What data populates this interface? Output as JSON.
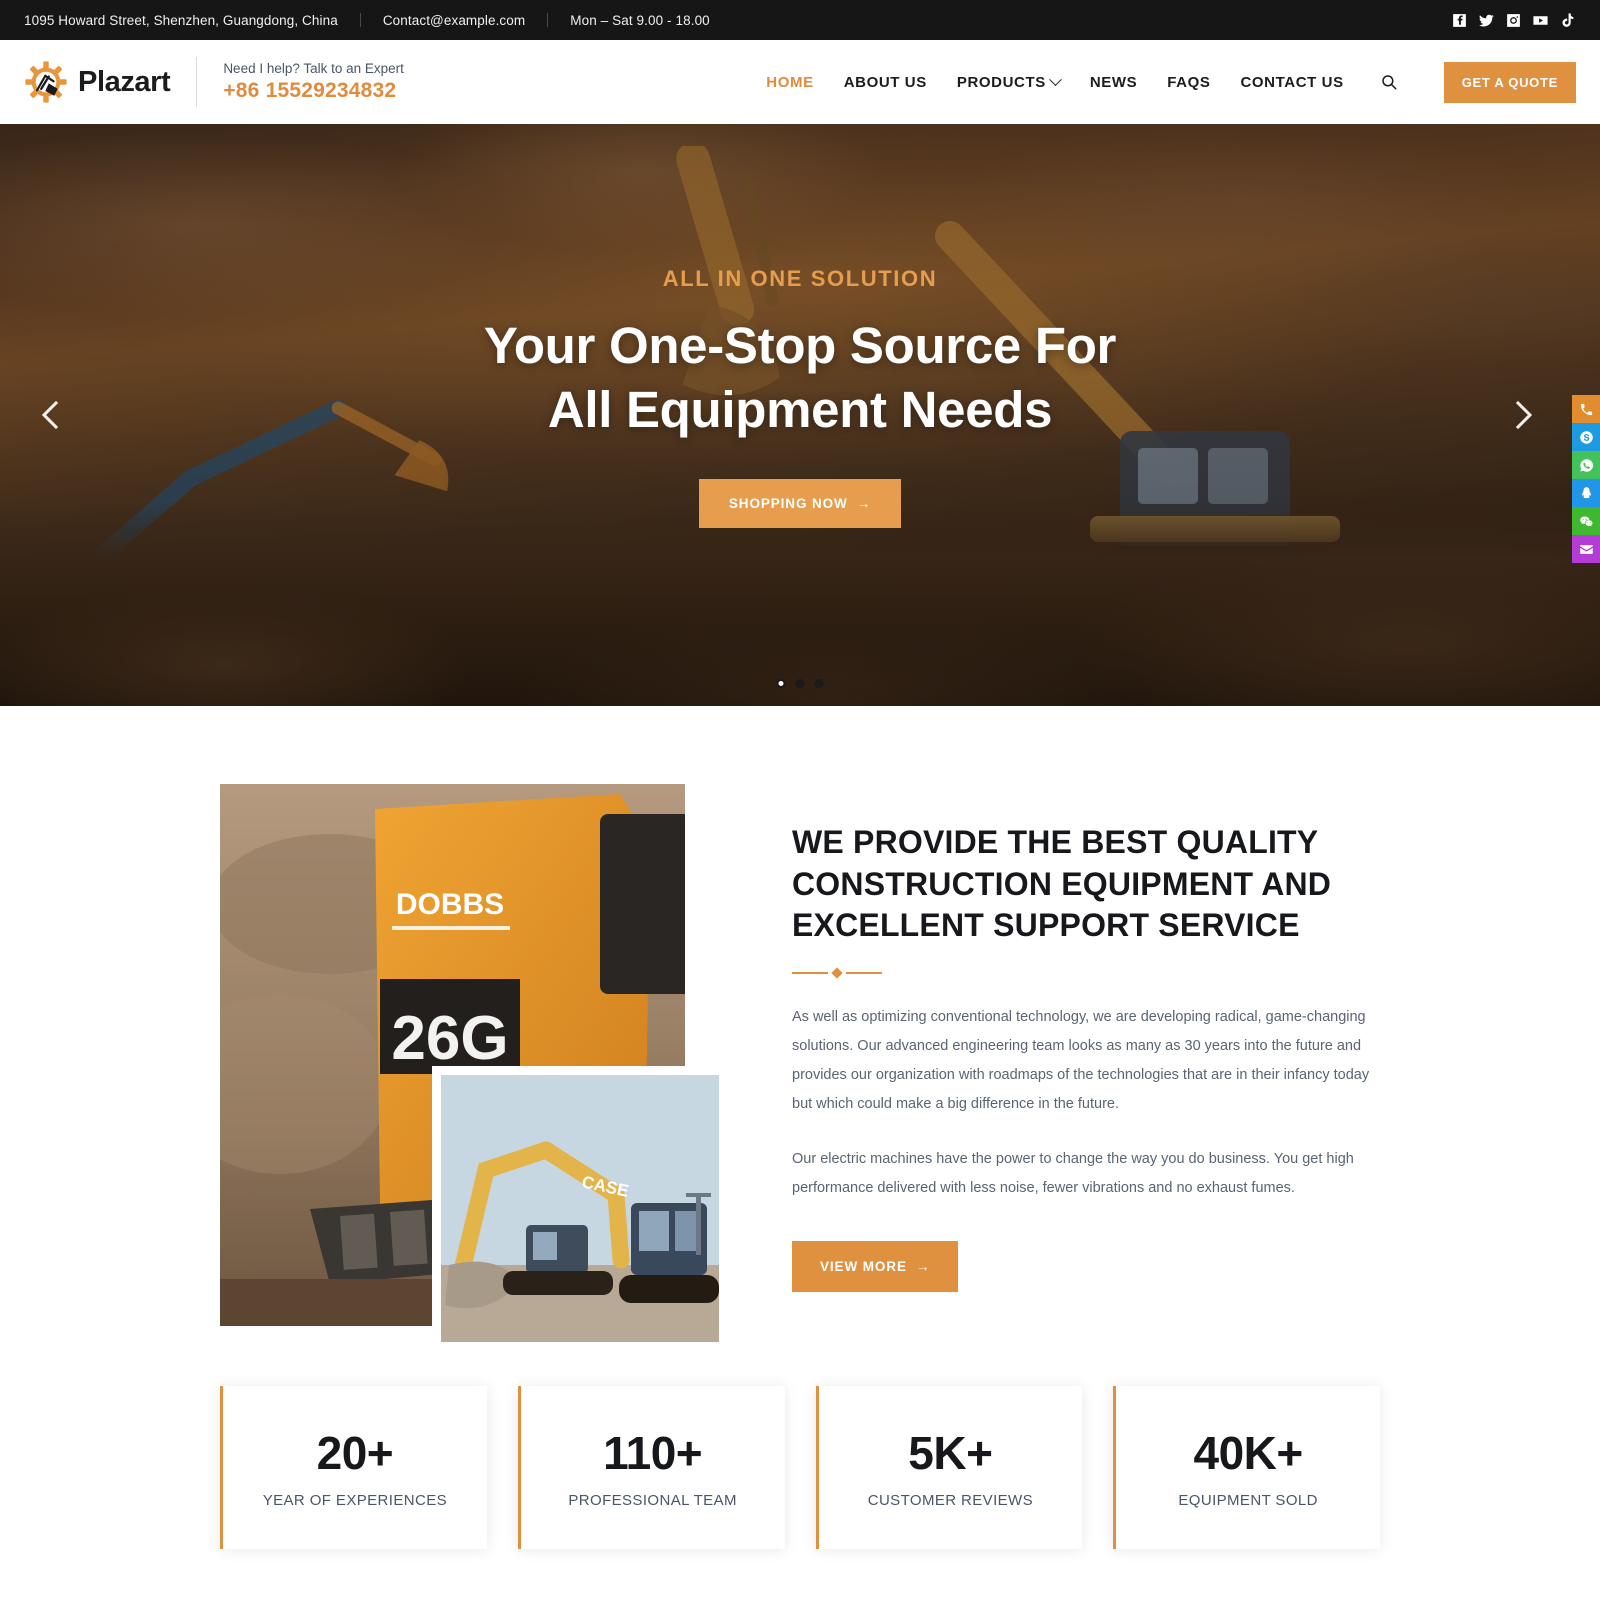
{
  "topbar": {
    "address": "1095 Howard Street, Shenzhen, Guangdong, China",
    "email": "Contact@example.com",
    "hours": "Mon – Sat 9.00 - 18.00",
    "socials": [
      {
        "name": "facebook-icon",
        "label": "Facebook"
      },
      {
        "name": "twitter-icon",
        "label": "Twitter"
      },
      {
        "name": "instagram-icon",
        "label": "Instagram"
      },
      {
        "name": "youtube-icon",
        "label": "YouTube"
      },
      {
        "name": "tiktok-icon",
        "label": "TikTok"
      }
    ]
  },
  "header": {
    "brand": "Plazart",
    "expert_label": "Need I help? Talk to an Expert",
    "phone": "+86 15529234832",
    "nav": [
      {
        "label": "HOME",
        "active": true,
        "caret": false
      },
      {
        "label": "ABOUT US",
        "active": false,
        "caret": false
      },
      {
        "label": "PRODUCTS",
        "active": false,
        "caret": true
      },
      {
        "label": "NEWS",
        "active": false,
        "caret": false
      },
      {
        "label": "FAQS",
        "active": false,
        "caret": false
      },
      {
        "label": "CONTACT US",
        "active": false,
        "caret": false
      }
    ],
    "search_icon": "search-icon",
    "quote_label": "GET A QUOTE"
  },
  "hero": {
    "eyebrow": "ALL IN ONE SOLUTION",
    "title": "Your One-Stop Source For All Equipment Needs",
    "cta_label": "SHOPPING NOW",
    "cta_arrow": "→",
    "prev_icon": "chevron-left-icon",
    "next_icon": "chevron-right-icon",
    "slides": 3,
    "active_slide": 1
  },
  "side_dock": [
    {
      "name": "phone-icon",
      "label": "Phone",
      "color": "#e18c2e"
    },
    {
      "name": "skype-icon",
      "label": "Skype",
      "color": "#1e9ae0"
    },
    {
      "name": "whatsapp-icon",
      "label": "WhatsApp",
      "color": "#43c15a"
    },
    {
      "name": "qq-icon",
      "label": "QQ",
      "color": "#2196e8"
    },
    {
      "name": "wechat-icon",
      "label": "WeChat",
      "color": "#3fb82f"
    },
    {
      "name": "email-icon",
      "label": "Email",
      "color": "#b23cd4"
    }
  ],
  "about": {
    "heading": "WE PROVIDE THE BEST QUALITY CONSTRUCTION EQUIPMENT AND EXCELLENT SUPPORT SERVICE",
    "paragraph_1": "As well as optimizing conventional technology, we are developing radical, game-changing solutions. Our advanced engineering team looks as many as 30 years into the future and provides our organization with roadmaps of the technologies that are in their infancy today but which could make a big difference in the future.",
    "paragraph_2": "Our electric machines have the power to change the way you do business. You get high performance delivered with less noise, fewer vibrations and no exhaust fumes.",
    "button_label": "VIEW MORE",
    "button_arrow": "→",
    "image_main_caption": "DOBBS 26G",
    "image_inset_caption": "CASE"
  },
  "stats": [
    {
      "value": "20+",
      "label": "YEAR OF EXPERIENCES"
    },
    {
      "value": "110+",
      "label": "PROFESSIONAL TEAM"
    },
    {
      "value": "5K+",
      "label": "CUSTOMER REVIEWS"
    },
    {
      "value": "40K+",
      "label": "EQUIPMENT SOLD"
    }
  ],
  "colors": {
    "accent": "#e0913f",
    "accent_light": "#e79d4e",
    "dark": "#161616",
    "text": "#16181c",
    "muted": "#5a6473"
  }
}
